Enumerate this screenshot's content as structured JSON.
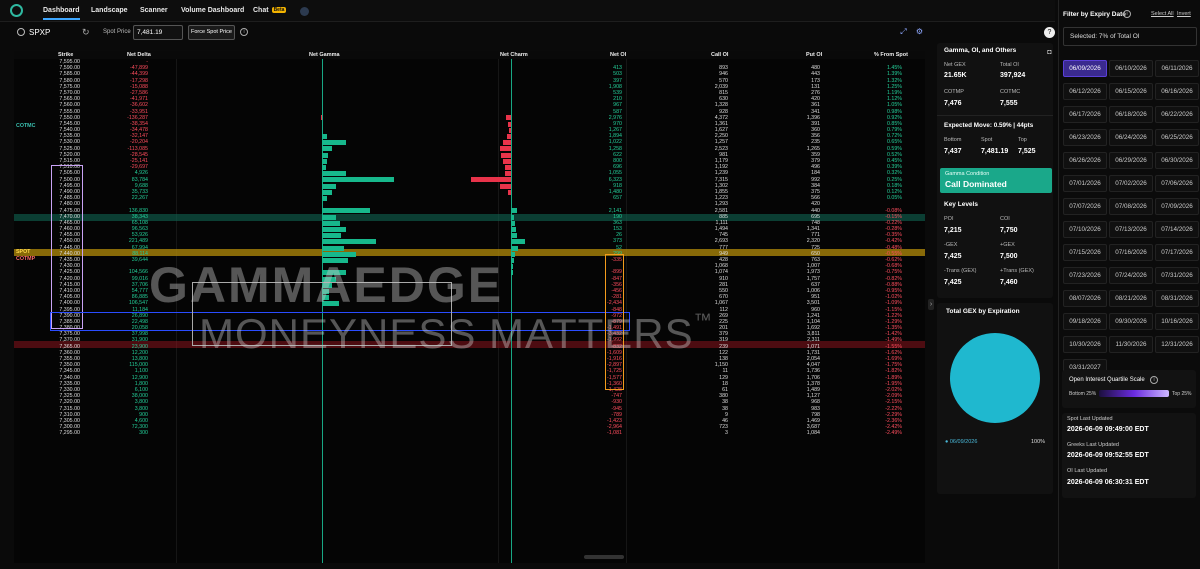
{
  "nav": {
    "tabs": [
      "Dashboard",
      "Landscape",
      "Scanner",
      "Volume Dashboard",
      "Chat"
    ],
    "chat_badge": "Beta"
  },
  "toolbar": {
    "symbol": "SPXP",
    "spot_label": "Spot Price",
    "spot_value": "7,481.19",
    "force_label": "Force Spot Price"
  },
  "columns": [
    "Strike",
    "Net Delta",
    "Net Gamma",
    "Net Charm",
    "Net OI",
    "Call OI",
    "Put OI",
    "% From Spot"
  ],
  "row_labels": {
    "cotmc": "COTMC",
    "spot": "SPOT",
    "cotmp": "COTMP"
  },
  "watermark": {
    "line1": "GAMMAEDGE",
    "line2": "MONEYNESS MATTERS",
    "tm": "™"
  },
  "rows": [
    [
      "7,595.00",
      "-",
      "",
      "",
      ""
    ],
    [
      "7,590.00",
      "-47,899",
      "413",
      "893",
      "480",
      "1.45%"
    ],
    [
      "7,585.00",
      "-44,399",
      "503",
      "946",
      "443",
      "1.39%"
    ],
    [
      "7,580.00",
      "-17,298",
      "397",
      "570",
      "173",
      "1.32%"
    ],
    [
      "7,575.00",
      "-15,088",
      "1,908",
      "2,039",
      "131",
      "1.25%"
    ],
    [
      "7,570.00",
      "-27,586",
      "539",
      "815",
      "276",
      "1.19%"
    ],
    [
      "7,565.00",
      "-41,971",
      "210",
      "630",
      "420",
      "1.12%"
    ],
    [
      "7,560.00",
      "-36,602",
      "967",
      "1,328",
      "361",
      "1.05%"
    ],
    [
      "7,555.00",
      "-33,951",
      "587",
      "928",
      "341",
      "0.98%"
    ],
    [
      "7,550.00",
      "-136,287",
      "2,976",
      "4,372",
      "1,396",
      "0.92%"
    ],
    [
      "7,545.00",
      "-38,354",
      "970",
      "1,361",
      "391",
      "0.85%"
    ],
    [
      "7,540.00",
      "-34,478",
      "1,267",
      "1,627",
      "360",
      "0.79%"
    ],
    [
      "7,535.00",
      "-32,147",
      "1,894",
      "2,250",
      "356",
      "0.72%"
    ],
    [
      "7,530.00",
      "-20,204",
      "1,022",
      "1,257",
      "235",
      "0.65%"
    ],
    [
      "7,525.00",
      "-113,085",
      "1,258",
      "2,523",
      "1,265",
      "0.59%"
    ],
    [
      "7,520.00",
      "-28,545",
      "622",
      "981",
      "359",
      "0.52%"
    ],
    [
      "7,515.00",
      "-25,141",
      "800",
      "1,179",
      "379",
      "0.45%"
    ],
    [
      "7,510.00",
      "-29,697",
      "696",
      "1,192",
      "496",
      "0.39%"
    ],
    [
      "7,505.00",
      "4,926",
      "1,055",
      "1,239",
      "184",
      "0.32%"
    ],
    [
      "7,500.00",
      "83,784",
      "6,323",
      "7,315",
      "992",
      "0.25%"
    ],
    [
      "7,495.00",
      "9,688",
      "918",
      "1,302",
      "384",
      "0.18%"
    ],
    [
      "7,490.00",
      "35,733",
      "1,480",
      "1,855",
      "375",
      "0.12%"
    ],
    [
      "7,485.00",
      "22,267",
      "657",
      "1,223",
      "566",
      "0.05%"
    ],
    [
      "7,480.00",
      "",
      "",
      "1,293",
      "420",
      ""
    ],
    [
      "7,475.00",
      "136,830",
      "2,141",
      "2,581",
      "440",
      "-0.08%"
    ],
    [
      "7,470.00",
      "38,343",
      "190",
      "885",
      "695",
      "-0.15%"
    ],
    [
      "7,465.00",
      "65,108",
      "363",
      "1,111",
      "748",
      "-0.22%"
    ],
    [
      "7,460.00",
      "96,563",
      "153",
      "1,494",
      "1,341",
      "-0.28%"
    ],
    [
      "7,455.00",
      "53,926",
      "26",
      "745",
      "771",
      "-0.35%"
    ],
    [
      "7,450.00",
      "221,489",
      "373",
      "2,693",
      "2,320",
      "-0.42%"
    ],
    [
      "7,445.00",
      "67,994",
      "52",
      "777",
      "725",
      "-0.48%"
    ],
    [
      "7,440.00",
      "88,114",
      "299",
      "949",
      "650",
      "-0.55%"
    ],
    [
      "7,435.00",
      "39,644",
      "-335",
      "428",
      "763",
      "-0.62%"
    ],
    [
      "7,430.00",
      "",
      "",
      "1,068",
      "1,007",
      "-0.68%"
    ],
    [
      "7,425.00",
      "104,566",
      "-899",
      "1,074",
      "1,973",
      "-0.75%"
    ],
    [
      "7,420.00",
      "99,016",
      "-847",
      "910",
      "1,757",
      "-0.82%"
    ],
    [
      "7,415.00",
      "37,706",
      "-356",
      "281",
      "637",
      "-0.88%"
    ],
    [
      "7,410.00",
      "54,777",
      "-456",
      "550",
      "1,006",
      "-0.95%"
    ],
    [
      "7,405.00",
      "86,885",
      "-281",
      "670",
      "951",
      "-1.02%"
    ],
    [
      "7,400.00",
      "106,547",
      "-2,434",
      "1,067",
      "3,501",
      "-1.09%"
    ],
    [
      "7,395.00",
      "11,184",
      "-848",
      "112",
      "960",
      "-1.15%"
    ],
    [
      "7,390.00",
      "26,890",
      "-972",
      "269",
      "1,241",
      "-1.22%"
    ],
    [
      "7,385.00",
      "22,498",
      "-879",
      "225",
      "1,104",
      "-1.29%"
    ],
    [
      "7,380.00",
      "20,058",
      "-1,491",
      "201",
      "1,692",
      "-1.35%"
    ],
    [
      "7,375.00",
      "37,998",
      "-3,432",
      "379",
      "3,811",
      "-1.42%"
    ],
    [
      "7,370.00",
      "31,900",
      "-1,992",
      "319",
      "2,311",
      "-1.49%"
    ],
    [
      "7,365.00",
      "23,900",
      "-832",
      "239",
      "1,071",
      "-1.55%"
    ],
    [
      "7,360.00",
      "12,200",
      "-1,609",
      "122",
      "1,731",
      "-1.62%"
    ],
    [
      "7,355.00",
      "13,800",
      "-1,916",
      "138",
      "2,054",
      "-1.69%"
    ],
    [
      "7,350.00",
      "115,000",
      "-2,897",
      "1,150",
      "4,047",
      "-1.75%"
    ],
    [
      "7,345.00",
      "1,100",
      "-1,725",
      "11",
      "1,736",
      "-1.82%"
    ],
    [
      "7,340.00",
      "12,900",
      "-1,577",
      "129",
      "1,706",
      "-1.89%"
    ],
    [
      "7,335.00",
      "1,800",
      "-1,360",
      "18",
      "1,378",
      "-1.95%"
    ],
    [
      "7,330.00",
      "6,100",
      "-1,428",
      "61",
      "1,489",
      "-2.02%"
    ],
    [
      "7,325.00",
      "38,000",
      "-747",
      "380",
      "1,127",
      "-2.09%"
    ],
    [
      "7,320.00",
      "3,800",
      "-930",
      "38",
      "968",
      "-2.15%"
    ],
    [
      "7,315.00",
      "3,800",
      "-945",
      "38",
      "983",
      "-2.22%"
    ],
    [
      "7,310.00",
      "900",
      "-789",
      "9",
      "798",
      "-2.29%"
    ],
    [
      "7,305.00",
      "4,600",
      "-1,423",
      "46",
      "1,469",
      "-2.36%"
    ],
    [
      "7,300.00",
      "72,300",
      "-2,964",
      "723",
      "3,687",
      "-2.42%"
    ],
    [
      "7,295.00",
      "300",
      "-1,081",
      "3",
      "1,084",
      "-2.49%"
    ]
  ],
  "gamma_bars": [
    [
      9,
      -1
    ],
    [
      12,
      4
    ],
    [
      13,
      20
    ],
    [
      14,
      8
    ],
    [
      15,
      5
    ],
    [
      16,
      4
    ],
    [
      17,
      3
    ],
    [
      18,
      20
    ],
    [
      19,
      60
    ],
    [
      20,
      12
    ],
    [
      21,
      8
    ],
    [
      22,
      4
    ],
    [
      24,
      40
    ],
    [
      25,
      12
    ],
    [
      26,
      15
    ],
    [
      27,
      20
    ],
    [
      28,
      16
    ],
    [
      29,
      45
    ],
    [
      30,
      18
    ],
    [
      31,
      28
    ],
    [
      32,
      22
    ],
    [
      34,
      20
    ],
    [
      35,
      12
    ],
    [
      36,
      8
    ],
    [
      37,
      6
    ],
    [
      38,
      6
    ],
    [
      39,
      14
    ]
  ],
  "charm_bars": [
    [
      9,
      -6
    ],
    [
      10,
      -4
    ],
    [
      11,
      -3
    ],
    [
      12,
      -5
    ],
    [
      13,
      -10
    ],
    [
      14,
      -14
    ],
    [
      15,
      -12
    ],
    [
      16,
      -10
    ],
    [
      17,
      -8
    ],
    [
      18,
      -7
    ],
    [
      19,
      -50
    ],
    [
      20,
      -14
    ],
    [
      21,
      -4
    ],
    [
      24,
      8
    ],
    [
      25,
      4
    ],
    [
      26,
      5
    ],
    [
      27,
      6
    ],
    [
      28,
      7
    ],
    [
      29,
      18
    ],
    [
      30,
      9
    ],
    [
      31,
      5
    ],
    [
      32,
      4
    ],
    [
      33,
      3
    ],
    [
      34,
      2
    ]
  ],
  "side": {
    "title": "Gamma, OI, and Others",
    "net_gex_label": "Net GEX",
    "net_gex": "21.65K",
    "total_oi_label": "Total OI",
    "total_oi": "397,924",
    "cotmp_label": "COTMP",
    "cotmp": "7,476",
    "cotmc_label": "COTMC",
    "cotmc": "7,555",
    "exp_move_title": "Expected Move: 0.59% | 44pts",
    "bottom_label": "Bottom",
    "bottom": "7,437",
    "spot_label": "Spot",
    "spot": "7,481.19",
    "top_label": "Top",
    "top": "7,525",
    "gamma_cond_label": "Gamma Condition",
    "gamma_cond": "Call Dominated",
    "key_title": "Key Levels",
    "poi_label": "POI",
    "poi": "7,215",
    "coi_label": "COI",
    "coi": "7,750",
    "mgex_label": "-GEX",
    "mgex": "7,425",
    "pgex_label": "+GEX",
    "pgex": "7,500",
    "mtrans_label": "-Trans (GEX)",
    "mtrans": "7,425",
    "ptrans_label": "+Trans (GEX)",
    "ptrans": "7,460",
    "gex_exp_title": "Total GEX by Expiration",
    "pie_legend": "06/09/2026",
    "pie_pct": "100%",
    "pie_color": "#1fb8cf"
  },
  "right": {
    "filter_title": "Filter by Expiry Date",
    "select_all": "Select All",
    "invert": "Invert",
    "selected": "Selected: 7% of Total OI",
    "dates": [
      "06/09/2026",
      "06/10/2026",
      "06/11/2026",
      "06/12/2026",
      "06/15/2026",
      "06/16/2026",
      "06/17/2026",
      "06/18/2026",
      "06/22/2026",
      "06/23/2026",
      "06/24/2026",
      "06/25/2026",
      "06/26/2026",
      "06/29/2026",
      "06/30/2026",
      "07/01/2026",
      "07/02/2026",
      "07/06/2026",
      "07/07/2026",
      "07/08/2026",
      "07/09/2026",
      "07/10/2026",
      "07/13/2026",
      "07/14/2026",
      "07/15/2026",
      "07/16/2026",
      "07/17/2026",
      "07/23/2026",
      "07/24/2026",
      "07/31/2026",
      "08/07/2026",
      "08/21/2026",
      "08/31/2026",
      "09/18/2026",
      "09/30/2026",
      "10/16/2026",
      "10/30/2026",
      "11/30/2026",
      "12/31/2026",
      "03/31/2027"
    ],
    "quartile_title": "Open Interest Quartile Scale",
    "bottom25": "Bottom 25%",
    "top25": "Top 25%",
    "spot_updated_label": "Spot Last Updated",
    "spot_updated": "2026-06-09 09:49:00 EDT",
    "greeks_updated_label": "Greeks Last Updated",
    "greeks_updated": "2026-06-09 09:52:55 EDT",
    "oi_updated_label": "OI Last Updated",
    "oi_updated": "2026-06-09 06:30:31 EDT"
  }
}
